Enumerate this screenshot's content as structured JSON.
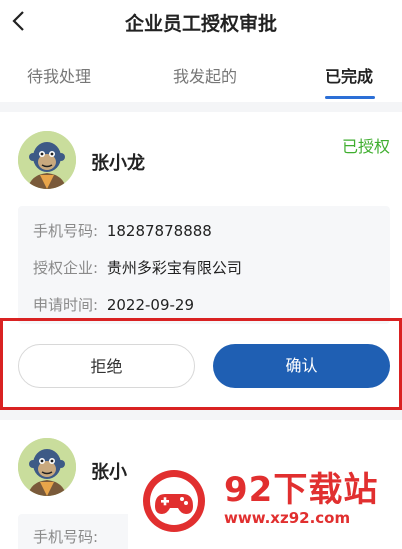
{
  "header": {
    "title": "企业员工授权审批",
    "back_icon": "chevron-left-icon"
  },
  "tabs": [
    {
      "label": "待我处理"
    },
    {
      "label": "我发起的"
    },
    {
      "label": "已完成",
      "active": true
    }
  ],
  "cards": [
    {
      "name": "张小龙",
      "status": "已授权",
      "phone_label": "手机号码:",
      "phone": "18287878888",
      "company_label": "授权企业:",
      "company": "贵州多彩宝有限公司",
      "time_label": "申请时间:",
      "time": "2022-09-29",
      "reject_label": "拒绝",
      "confirm_label": "确认"
    },
    {
      "name": "张小",
      "phone_label": "手机号码:"
    }
  ],
  "watermark": {
    "title": "92下载站",
    "url": "www.xz92.com"
  },
  "colors": {
    "accent": "#1f5fb3",
    "status_green": "#3fae2f",
    "highlight_red": "#d92222",
    "watermark_red": "#e12f2f"
  }
}
